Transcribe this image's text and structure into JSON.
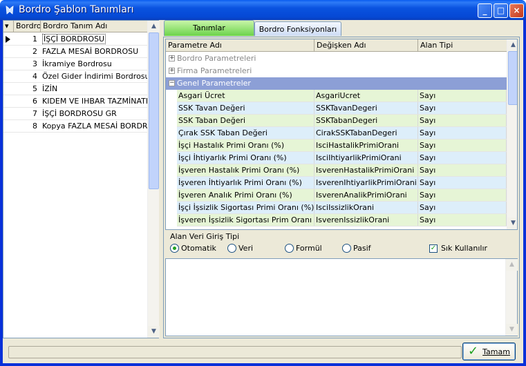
{
  "window": {
    "title": "Bordro Şablon Tanımları",
    "minimize": "_",
    "maximize": "□",
    "close": "×"
  },
  "left_grid": {
    "headers": [
      "BordroT",
      "Bordro Tanım Adı"
    ],
    "rows": [
      {
        "num": "1",
        "name": "İŞÇİ BORDROSU"
      },
      {
        "num": "2",
        "name": "FAZLA MESAİ BORDROSU"
      },
      {
        "num": "3",
        "name": "İkramiye Bordrosu"
      },
      {
        "num": "4",
        "name": "Özel Gider İndirimi Bordrosu"
      },
      {
        "num": "5",
        "name": "İZİN"
      },
      {
        "num": "6",
        "name": "KIDEM VE IHBAR TAZMİNATI"
      },
      {
        "num": "7",
        "name": " İŞÇİ BORDROSU GR"
      },
      {
        "num": "8",
        "name": "Kopya FAZLA MESAİ BORDROSU"
      }
    ],
    "selected_index": 0
  },
  "tabs": [
    {
      "label": "Tanımlar",
      "active": true
    },
    {
      "label": "Bordro Fonksiyonları",
      "active": false
    }
  ],
  "param_grid": {
    "headers": [
      "Parametre Adı",
      "Değişken Adı",
      "Alan Tipi"
    ],
    "groups": [
      {
        "label": "Bordro Parametreleri",
        "expanded": false,
        "toggle": "+"
      },
      {
        "label": "Firma Parametreleri",
        "expanded": false,
        "toggle": "+"
      },
      {
        "label": "Genel Parametreler",
        "expanded": true,
        "toggle": "−"
      }
    ],
    "rows": [
      {
        "name": "Asgari Ücret",
        "var": "AsgariUcret",
        "type": "Sayı"
      },
      {
        "name": "SSK Tavan Değeri",
        "var": "SSKTavanDegeri",
        "type": "Sayı"
      },
      {
        "name": "SSK Taban Değeri",
        "var": "SSKTabanDegeri",
        "type": "Sayı"
      },
      {
        "name": "Çırak SSK Taban Değeri",
        "var": "CirakSSKTabanDegeri",
        "type": "Sayı"
      },
      {
        "name": "İşçi Hastalık Primi Oranı (%)",
        "var": "IsciHastalikPrimiOrani",
        "type": "Sayı"
      },
      {
        "name": "İşçi İhtiyarlık Primi Oranı (%)",
        "var": "IsciIhtiyarlikPrimiOrani",
        "type": "Sayı"
      },
      {
        "name": "İşveren Hastalık Primi Oranı (%)",
        "var": "IsverenHastalikPrimiOrani",
        "type": "Sayı"
      },
      {
        "name": "İşveren İhtiyarlık Primi Oranı (%)",
        "var": "IsverenIhtiyarlikPrimiOrani",
        "type": "Sayı"
      },
      {
        "name": "İşveren Analık Primi  Oranı (%)",
        "var": "IsverenAnalikPrimiOrani",
        "type": "Sayı"
      },
      {
        "name": "İşçi İşsizlik Sigortası Primi Oranı (%)",
        "var": "IsciIssizlikOrani",
        "type": "Sayı"
      },
      {
        "name": "İşveren İşsizlik Sigortası Prim Oranı (%)",
        "var": "IsverenIssizlikOrani",
        "type": "Sayı"
      }
    ]
  },
  "input_type": {
    "title": "Alan Veri Giriş Tipi",
    "options": [
      {
        "label": "Otomatik",
        "selected": true
      },
      {
        "label": "Veri",
        "selected": false
      },
      {
        "label": "Formül",
        "selected": false
      },
      {
        "label": "Pasif",
        "selected": false
      }
    ],
    "frequent_label": "Sık Kullanılır",
    "frequent_checked": true
  },
  "ok_button": {
    "label": "Tamam"
  },
  "colors": {
    "group_open": "#8c9fd6",
    "row_green": "#e6f5d6",
    "row_blue": "#ddeefa",
    "tab_active": "#6bd34a"
  }
}
